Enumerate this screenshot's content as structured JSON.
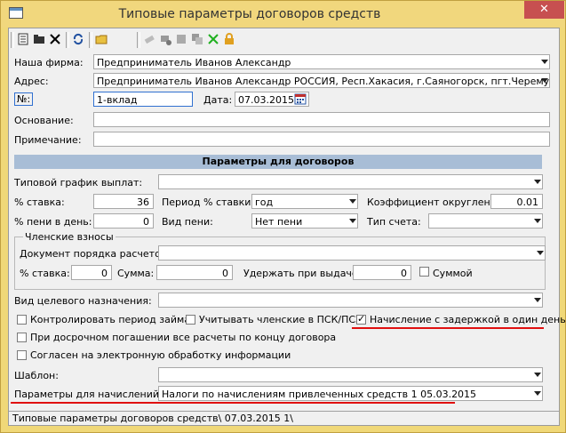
{
  "window": {
    "title": "Типовые параметры договоров средств",
    "close_glyph": "✕"
  },
  "form": {
    "firm_label": "Наша фирма:",
    "firm_value": "Предприниматель Иванов Александр",
    "address_label": "Адрес:",
    "address_value": "Предприниматель Иванов Александр РОССИЯ, Респ.Хакасия, г.Саяногорск, пгт.Черемушки",
    "number_label": "№:",
    "number_value": "1-вклад",
    "date_label": "Дата:",
    "date_value": "07.03.2015",
    "basis_label": "Основание:",
    "basis_value": "",
    "note_label": "Примечание:",
    "note_value": ""
  },
  "params": {
    "section_title": "Параметры для договоров",
    "schedule_label": "Типовой график выплат:",
    "schedule_value": "",
    "rate_label": "% ставка:",
    "rate_value": "36",
    "rate_period_label": "Период % ставки:",
    "rate_period_value": "год",
    "round_label": "Коэффициент округления:",
    "round_value": "0.01",
    "penalty_label": "% пени в день:",
    "penalty_value": "0",
    "penalty_type_label": "Вид пени:",
    "penalty_type_value": "Нет пени",
    "account_type_label": "Тип счета:",
    "account_type_value": ""
  },
  "member_fees": {
    "group_label": "Членские взносы",
    "doc_order_label": "Документ порядка расчетов:",
    "doc_order_value": "",
    "rate_label": "% ставка:",
    "rate_value": "0",
    "sum_label": "Сумма:",
    "sum_value": "0",
    "withhold_label": "Удержать при выдаче:",
    "withhold_value": "0",
    "sum_check_label": "Суммой"
  },
  "purpose_label": "Вид целевого назначения:",
  "purpose_value": "",
  "checks": {
    "control_period": "Контролировать период займа",
    "account_fees": "Учитывать членские в ПСК/ПСЗ",
    "delayed_accrual": "Начисление с задержкой в один день",
    "early_repay": "При досрочном погашении все расчеты по концу договора",
    "consent": "Согласен на электронную обработку информации"
  },
  "template_label": "Шаблон:",
  "template_value": "",
  "accrual_label": "Параметры для начислений:",
  "accrual_value": "Налоги по начислениям привлеченных средств 1 05.03.2015",
  "status_text": "Типовые параметры договоров средств\\ 07.03.2015 1\\",
  "colors": {
    "title_bar": "#f1d77d",
    "section_bar": "#a8bdd6",
    "highlight_line": "#e01010"
  }
}
